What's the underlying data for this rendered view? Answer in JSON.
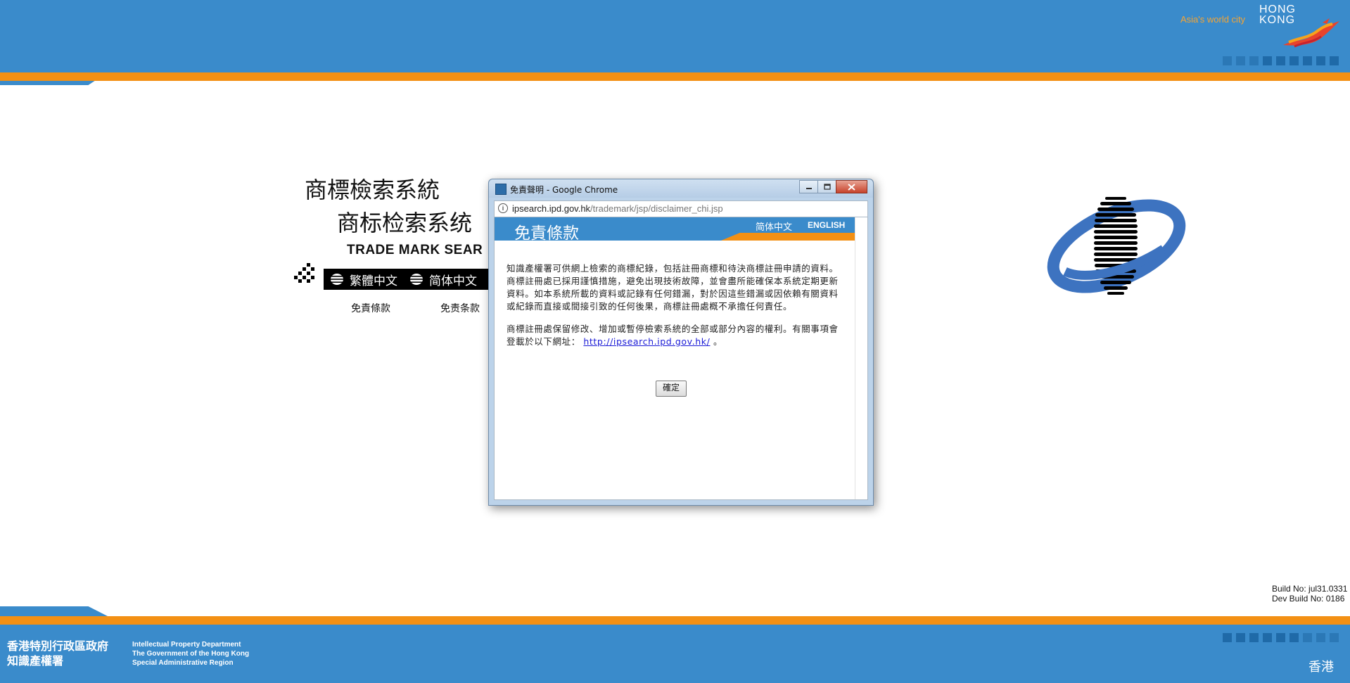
{
  "header": {
    "tagline": "Asia's world city",
    "brand_line1": "HONG",
    "brand_line2": "KONG"
  },
  "main": {
    "title_traditional": "商標檢索系統",
    "title_simplified": "商标检索系统",
    "title_english": "TRADE MARK SEAR",
    "lang_traditional": "繁體中文",
    "lang_simplified": "简体中文",
    "disclaimer_traditional": "免責條款",
    "disclaimer_simplified": "免责条款"
  },
  "build": {
    "build_no": "Build No: jul31.0331",
    "dev_build_no": "Dev Build No: 0186"
  },
  "footer": {
    "gov_zh_line1": "香港特別行政區政府",
    "gov_zh_line2": "知識產權署",
    "gov_en_line1": "Intellectual Property Department",
    "gov_en_line2": "The Government of  the Hong Kong",
    "gov_en_line3": "Special Administrative Region",
    "hk_zh": "香港"
  },
  "popup": {
    "window_title": "免責聲明 - Google Chrome",
    "url_host": "ipsearch.ipd.gov.hk",
    "url_path": "/trademark/jsp/disclaimer_chi.jsp",
    "heading": "免責條款",
    "lang_simplified": "简体中文",
    "lang_english": "ENGLISH",
    "paragraph1": "知識產權署可供網上檢索的商標紀錄，包括註冊商標和待決商標註冊申請的資料。商標註冊處已採用謹慎措施，避免出現技術故障，並會盡所能確保本系統定期更新資料。如本系統所載的資料或記錄有任何錯漏，對於因這些錯漏或因依賴有關資料或紀錄而直接或間接引致的任何後果，商標註冊處概不承擔任何責任。",
    "paragraph2_before": "商標註冊處保留修改、增加或暫停檢索系統的全部或部分內容的權利。有關事項會登載於以下網址：",
    "paragraph2_link": "http://ipsearch.ipd.gov.hk/",
    "paragraph2_after": " 。",
    "ok_label": "確定"
  },
  "colors": {
    "brand_blue": "#3a8bcb",
    "brand_orange": "#f39014",
    "link_blue": "#1a1ad6"
  },
  "icons": [
    "hong-kong-dragon-icon",
    "dots-icon",
    "globe-icon",
    "ipd-logo-icon",
    "info-icon",
    "minimize-icon",
    "maximize-icon",
    "close-icon"
  ]
}
